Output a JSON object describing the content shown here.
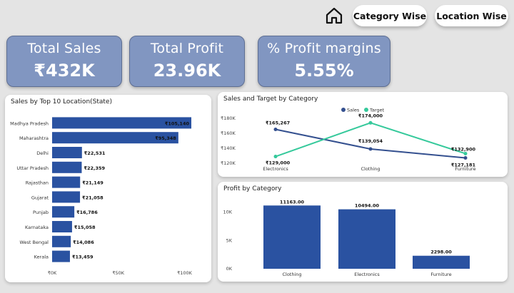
{
  "nav": {
    "home_icon": "home-icon",
    "buttons": [
      {
        "label": "Category Wise"
      },
      {
        "label": "Location Wise"
      }
    ]
  },
  "kpis": [
    {
      "label": "Total Sales",
      "value": "₹432K"
    },
    {
      "label": "Total Profit",
      "value": "23.96K"
    },
    {
      "label": "% Profit margins",
      "value": "5.55%"
    }
  ],
  "colors": {
    "kpi_bg": "#8196c1",
    "bar": "#2a52a1",
    "sales_line": "#34508f",
    "target_line": "#35c99b",
    "page_bg": "#e4e4e4"
  },
  "chart_data": [
    {
      "type": "bar",
      "orientation": "horizontal",
      "title": "Sales by Top 10 Location(State)",
      "categories": [
        "Madhya Pradesh",
        "Maharashtra",
        "Delhi",
        "Uttar Pradesh",
        "Rajasthan",
        "Gujarat",
        "Punjab",
        "Karnataka",
        "West Bengal",
        "Kerala"
      ],
      "values": [
        105140,
        95348,
        22531,
        22359,
        21149,
        21058,
        16786,
        15058,
        14086,
        13459
      ],
      "data_labels": [
        "₹105,140",
        "₹95,348",
        "₹22,531",
        "₹22,359",
        "₹21,149",
        "₹21,058",
        "₹16,786",
        "₹15,058",
        "₹14,086",
        "₹13,459"
      ],
      "x_ticks": [
        0,
        50000,
        100000
      ],
      "x_tick_labels": [
        "₹0K",
        "₹50K",
        "₹100K"
      ],
      "xlim": [
        0,
        117000
      ]
    },
    {
      "type": "line",
      "title": "Sales and Target by Category",
      "categories": [
        "Electronics",
        "Clothing",
        "Furniture"
      ],
      "series": [
        {
          "name": "Sales",
          "values": [
            165267,
            139054,
            127181
          ],
          "data_labels": [
            "₹165,267",
            "₹139,054",
            "₹127,181"
          ]
        },
        {
          "name": "Target",
          "values": [
            129000,
            174000,
            132900
          ],
          "data_labels": [
            "₹129,000",
            "₹174,000",
            "₹132,900"
          ]
        }
      ],
      "y_ticks": [
        120000,
        140000,
        160000,
        180000
      ],
      "y_tick_labels": [
        "₹120K",
        "₹140K",
        "₹160K",
        "₹180K"
      ],
      "ylim": [
        120000,
        180000
      ],
      "legend": "top-center"
    },
    {
      "type": "bar",
      "title": "Profit by Category",
      "categories": [
        "Clothing",
        "Electronics",
        "Furniture"
      ],
      "values": [
        11163,
        10494,
        2298
      ],
      "data_labels": [
        "11163.00",
        "10494.00",
        "2298.00"
      ],
      "y_ticks": [
        0,
        5000,
        10000
      ],
      "y_tick_labels": [
        "0K",
        "5K",
        "10K"
      ],
      "ylim": [
        0,
        11700
      ]
    }
  ]
}
